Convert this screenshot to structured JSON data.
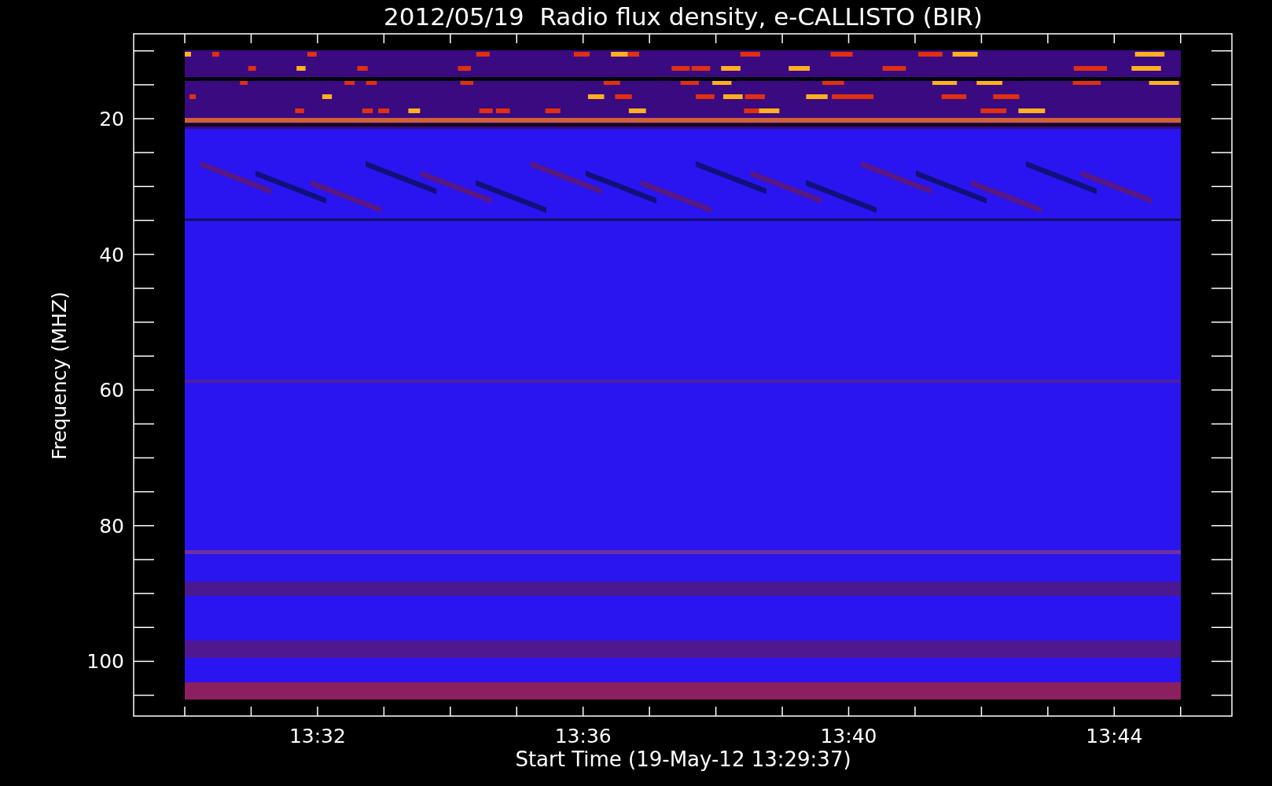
{
  "plot": {
    "title": "2012/05/19  Radio flux density, e-CALLISTO (BIR)",
    "xlabel": "Start Time (19-May-12 13:29:37)",
    "ylabel": "Frequency (MHZ)",
    "x_tick_labels": [
      "13:32",
      "13:36",
      "13:40",
      "13:44"
    ],
    "y_tick_labels": [
      "20",
      "40",
      "60",
      "80",
      "100"
    ]
  }
}
